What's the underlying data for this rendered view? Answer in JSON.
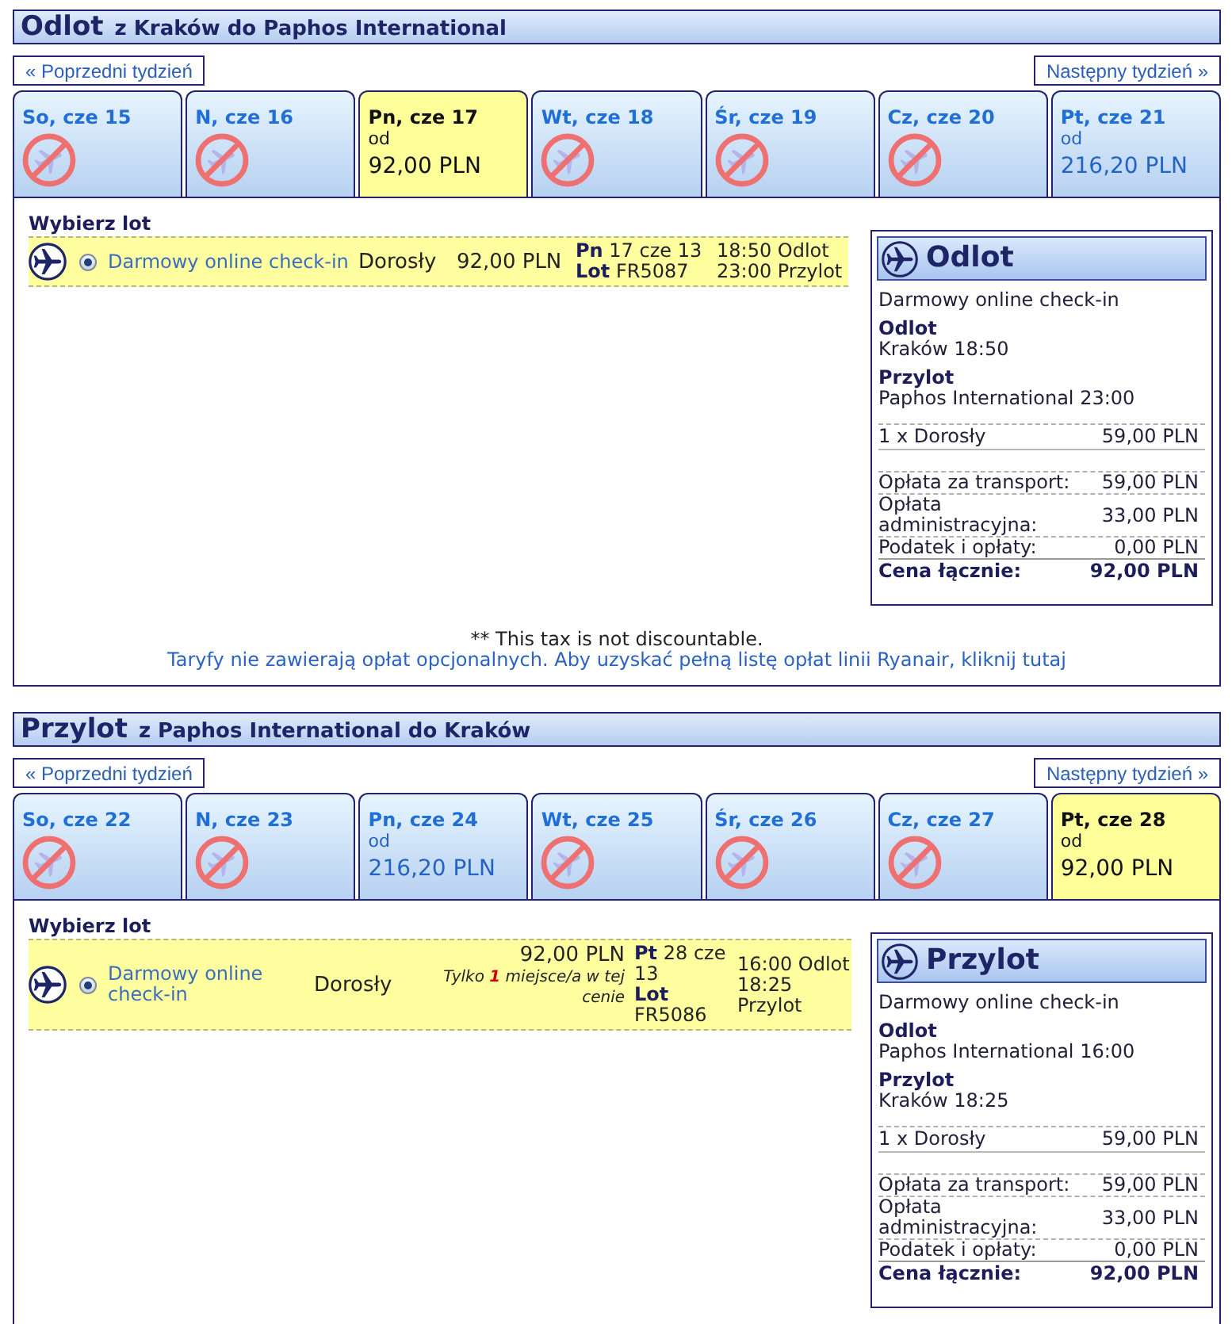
{
  "sections": [
    {
      "title": "Odlot",
      "route": "z Kraków do Paphos International",
      "prev_week": "« Poprzedni tydzień",
      "next_week": "Następny tydzień »",
      "days": [
        {
          "label": "So, cze 15",
          "selected": false,
          "available": false
        },
        {
          "label": "N, cze 16",
          "selected": false,
          "available": false
        },
        {
          "label": "Pn, cze 17",
          "selected": true,
          "available": true,
          "from": "od",
          "price": "92,00 PLN"
        },
        {
          "label": "Wt, cze 18",
          "selected": false,
          "available": false
        },
        {
          "label": "Śr, cze 19",
          "selected": false,
          "available": false
        },
        {
          "label": "Cz, cze 20",
          "selected": false,
          "available": false
        },
        {
          "label": "Pt, cze 21",
          "selected": false,
          "available": true,
          "from": "od",
          "price": "216,20 PLN"
        }
      ],
      "select_label": "Wybierz lot",
      "flights": [
        {
          "selected": true,
          "fare": "Darmowy online check-in",
          "passenger": "Dorosły",
          "price": "92,00 PLN",
          "day": "Pn",
          "date": "17 cze 13",
          "flight_label": "Lot",
          "flight_number": "FR5087",
          "departure": "18:50 Odlot",
          "arrival": "23:00 Przylot"
        }
      ],
      "summary": {
        "title": "Odlot",
        "fare": "Darmowy online check-in",
        "departure_label": "Odlot",
        "departure": "Kraków 18:50",
        "arrival_label": "Przylot",
        "arrival": "Paphos International 23:00",
        "passengers": [
          {
            "label": "1 x Dorosły",
            "amount": "59,00 PLN"
          }
        ],
        "charges": [
          {
            "label": "Opłata za transport:",
            "amount": "59,00 PLN"
          },
          {
            "label": "Opłata administracyjna:",
            "amount": "33,00 PLN"
          },
          {
            "label": "Podatek i opłaty:",
            "amount": "0,00 PLN"
          }
        ],
        "total_label": "Cena łącznie:",
        "total": "92,00 PLN"
      },
      "notes": {
        "tax": "** This tax is not discountable.",
        "fees_link": "Taryfy nie zawierają opłat opcjonalnych. Aby uzyskać pełną listę opłat linii Ryanair, kliknij tutaj"
      }
    },
    {
      "title": "Przylot",
      "route": "z Paphos International do Kraków",
      "prev_week": "« Poprzedni tydzień",
      "next_week": "Następny tydzień »",
      "days": [
        {
          "label": "So, cze 22",
          "selected": false,
          "available": false
        },
        {
          "label": "N, cze 23",
          "selected": false,
          "available": false
        },
        {
          "label": "Pn, cze 24",
          "selected": false,
          "available": true,
          "from": "od",
          "price": "216,20 PLN"
        },
        {
          "label": "Wt, cze 25",
          "selected": false,
          "available": false
        },
        {
          "label": "Śr, cze 26",
          "selected": false,
          "available": false
        },
        {
          "label": "Cz, cze 27",
          "selected": false,
          "available": false
        },
        {
          "label": "Pt, cze 28",
          "selected": true,
          "available": true,
          "from": "od",
          "price": "92,00 PLN"
        }
      ],
      "select_label": "Wybierz lot",
      "flights": [
        {
          "selected": true,
          "fare": "Darmowy online check-in",
          "passenger": "Dorosły",
          "price": "92,00 PLN",
          "note": "Tylko **1** miejsce/a w tej cenie",
          "day": "Pt",
          "date": "28 cze 13",
          "flight_label": "Lot",
          "flight_number": "FR5086",
          "departure": "16:00 Odlot",
          "arrival": "18:25 Przylot"
        }
      ],
      "summary": {
        "title": "Przylot",
        "fare": "Darmowy online check-in",
        "departure_label": "Odlot",
        "departure": "Paphos International 16:00",
        "arrival_label": "Przylot",
        "arrival": "Kraków 18:25",
        "passengers": [
          {
            "label": "1 x Dorosły",
            "amount": "59,00 PLN"
          }
        ],
        "charges": [
          {
            "label": "Opłata za transport:",
            "amount": "59,00 PLN"
          },
          {
            "label": "Opłata administracyjna:",
            "amount": "33,00 PLN"
          },
          {
            "label": "Podatek i opłaty:",
            "amount": "0,00 PLN"
          }
        ],
        "total_label": "Cena łącznie:",
        "total": "92,00 PLN"
      }
    }
  ]
}
